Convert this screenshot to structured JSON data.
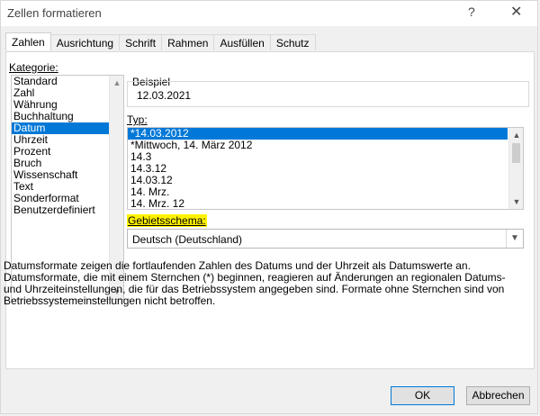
{
  "dialog": {
    "title": "Zellen formatieren",
    "help": "?",
    "close": "✕"
  },
  "tabs": [
    "Zahlen",
    "Ausrichtung",
    "Schrift",
    "Rahmen",
    "Ausfüllen",
    "Schutz"
  ],
  "kategorie": {
    "label": "Kategorie:",
    "items": [
      "Standard",
      "Zahl",
      "Währung",
      "Buchhaltung",
      "Datum",
      "Uhrzeit",
      "Prozent",
      "Bruch",
      "Wissenschaft",
      "Text",
      "Sonderformat",
      "Benutzerdefiniert"
    ],
    "selected": "Datum"
  },
  "beispiel": {
    "label": "Beispiel",
    "value": "12.03.2021"
  },
  "typ": {
    "label": "Typ:",
    "items": [
      "*14.03.2012",
      "*Mittwoch, 14. März 2012",
      "14.3",
      "14.3.12",
      "14.03.12",
      "14. Mrz.",
      "14. Mrz. 12"
    ],
    "selected": "*14.03.2012"
  },
  "gebietsschema": {
    "label": "Gebietsschema:",
    "value": "Deutsch (Deutschland)"
  },
  "description": "Datumsformate zeigen die fortlaufenden Zahlen des Datums und der Uhrzeit als Datumswerte an. Datumsformate, die mit einem Sternchen (*) beginnen, reagieren auf Änderungen an regionalen Datums- und Uhrzeiteinstellungen, die für das Betriebssystem angegeben sind. Formate ohne Sternchen sind von Betriebssystemeinstellungen nicht betroffen.",
  "buttons": {
    "ok": "OK",
    "cancel": "Abbrechen"
  },
  "colors": {
    "selection": "#0078d7",
    "highlight": "#fff200"
  }
}
